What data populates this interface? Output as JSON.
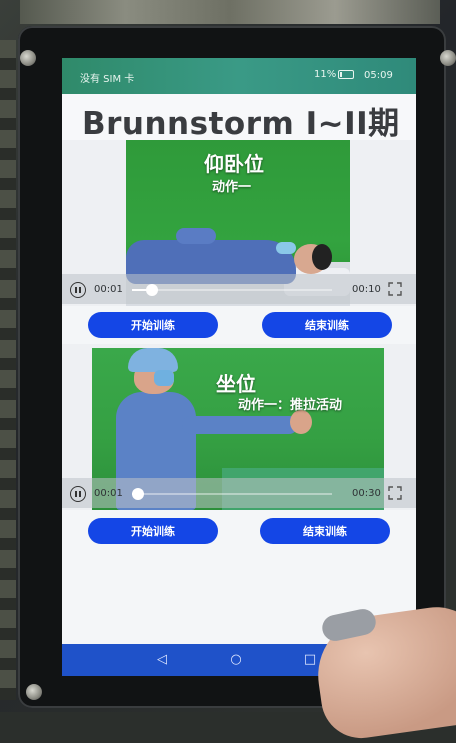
{
  "status_bar": {
    "carrier": "没有 SIM 卡",
    "battery": "11%",
    "time": "05:09"
  },
  "header": {
    "title": "Brunnstorm I~II期"
  },
  "video1": {
    "overlay_title": "仰卧位",
    "overlay_subtitle": "动作一",
    "current_time": "00:01",
    "total_time": "00:10",
    "progress": 0.1
  },
  "video2": {
    "overlay_title": "坐位",
    "overlay_subtitle": "动作一：推拉活动",
    "current_time": "00:01",
    "total_time": "00:30",
    "progress": 0.03
  },
  "buttons": {
    "start": "开始训练",
    "end": "结束训练"
  },
  "nav": {
    "back": "◁",
    "home": "○",
    "recent": "□"
  },
  "colors": {
    "accent": "#1446e6",
    "status_bar": "#3a9a86",
    "nav_bar": "#1f52c9"
  }
}
